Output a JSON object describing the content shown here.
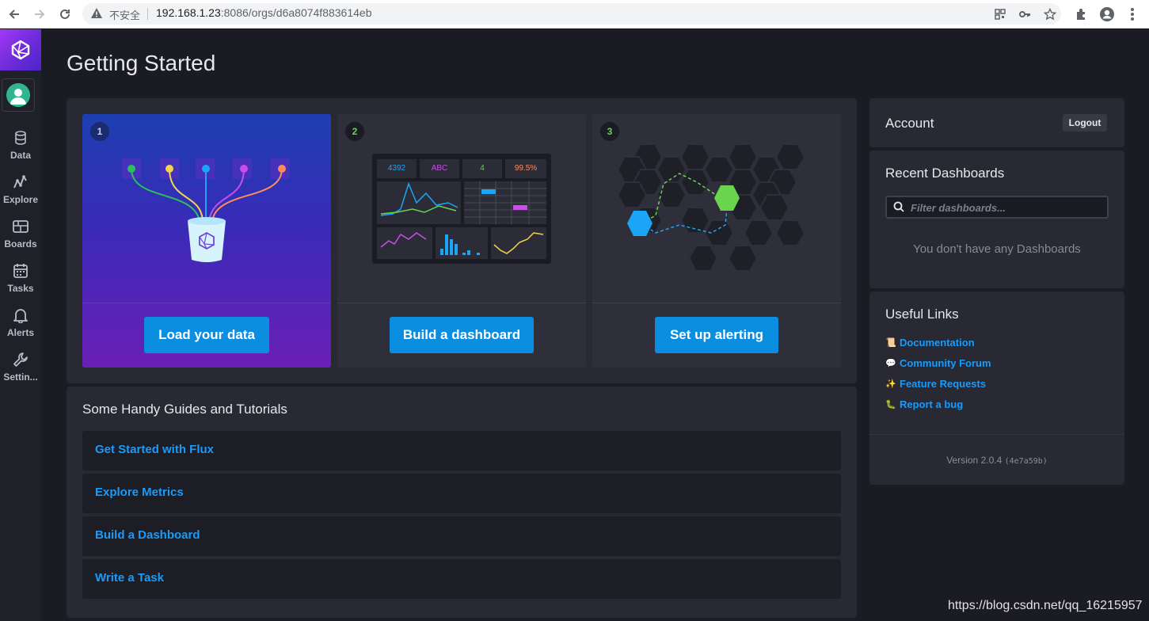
{
  "browser": {
    "insecure_label": "不安全",
    "url_host": "192.168.1.23",
    "url_rest": ":8086/orgs/d6a8074f883614eb"
  },
  "sidebar": {
    "items": [
      {
        "label": "Data",
        "icon": "database-icon"
      },
      {
        "label": "Explore",
        "icon": "graph-icon"
      },
      {
        "label": "Boards",
        "icon": "dashboard-icon"
      },
      {
        "label": "Tasks",
        "icon": "calendar-icon"
      },
      {
        "label": "Alerts",
        "icon": "bell-icon"
      },
      {
        "label": "Settin...",
        "icon": "wrench-icon"
      }
    ]
  },
  "main": {
    "title": "Getting Started",
    "steps": [
      {
        "number": "1",
        "button": "Load your data"
      },
      {
        "number": "2",
        "button": "Build a dashboard"
      },
      {
        "number": "3",
        "button": "Set up alerting"
      }
    ],
    "dashboard_preview": {
      "stats": [
        "4392",
        "ABC",
        "4",
        "99.5%"
      ]
    },
    "guides_title": "Some Handy Guides and Tutorials",
    "guides": [
      "Get Started with Flux",
      "Explore Metrics",
      "Build a Dashboard",
      "Write a Task"
    ]
  },
  "right": {
    "account_title": "Account",
    "logout_label": "Logout",
    "recent_title": "Recent Dashboards",
    "filter_placeholder": "Filter dashboards...",
    "empty_text": "You don't have any Dashboards",
    "links_title": "Useful Links",
    "links": [
      {
        "emoji": "📜",
        "label": "Documentation"
      },
      {
        "emoji": "💬",
        "label": "Community Forum"
      },
      {
        "emoji": "✨",
        "label": "Feature Requests"
      },
      {
        "emoji": "🐛",
        "label": "Report a bug"
      }
    ],
    "version_label": "Version 2.0.4",
    "version_hash": "(4e7a59b)"
  },
  "watermark": "https://blog.csdn.net/qq_16215957",
  "colors": {
    "accent": "#0c8ee0",
    "link": "#1a9bfa",
    "background": "#1b1b23",
    "panel": "#292933"
  }
}
